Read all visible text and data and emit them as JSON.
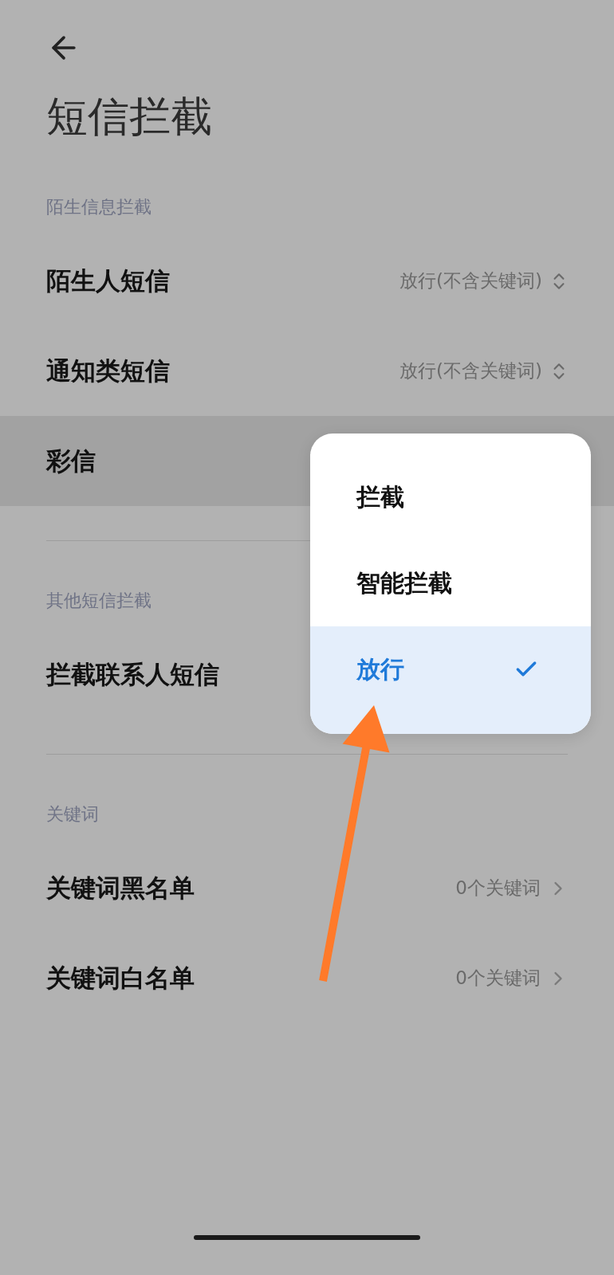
{
  "title": "短信拦截",
  "sections": [
    {
      "label": "陌生信息拦截",
      "rows": [
        {
          "kind": "select",
          "label": "陌生人短信",
          "value": "放行(不含关键词)",
          "highlighted": false
        },
        {
          "kind": "select",
          "label": "通知类短信",
          "value": "放行(不含关键词)",
          "highlighted": false
        },
        {
          "kind": "plain",
          "label": "彩信",
          "highlighted": true
        }
      ]
    },
    {
      "label": "其他短信拦截",
      "rows": [
        {
          "kind": "plain",
          "label": "拦截联系人短信",
          "highlighted": false
        }
      ]
    },
    {
      "label": "关键词",
      "rows": [
        {
          "kind": "link",
          "label": "关键词黑名单",
          "value": "0个关键词",
          "highlighted": false
        },
        {
          "kind": "link",
          "label": "关键词白名单",
          "value": "0个关键词",
          "highlighted": false
        }
      ]
    }
  ],
  "menu": [
    {
      "label": "拦截",
      "selected": false
    },
    {
      "label": "智能拦截",
      "selected": false
    },
    {
      "label": "放行",
      "selected": true
    }
  ]
}
